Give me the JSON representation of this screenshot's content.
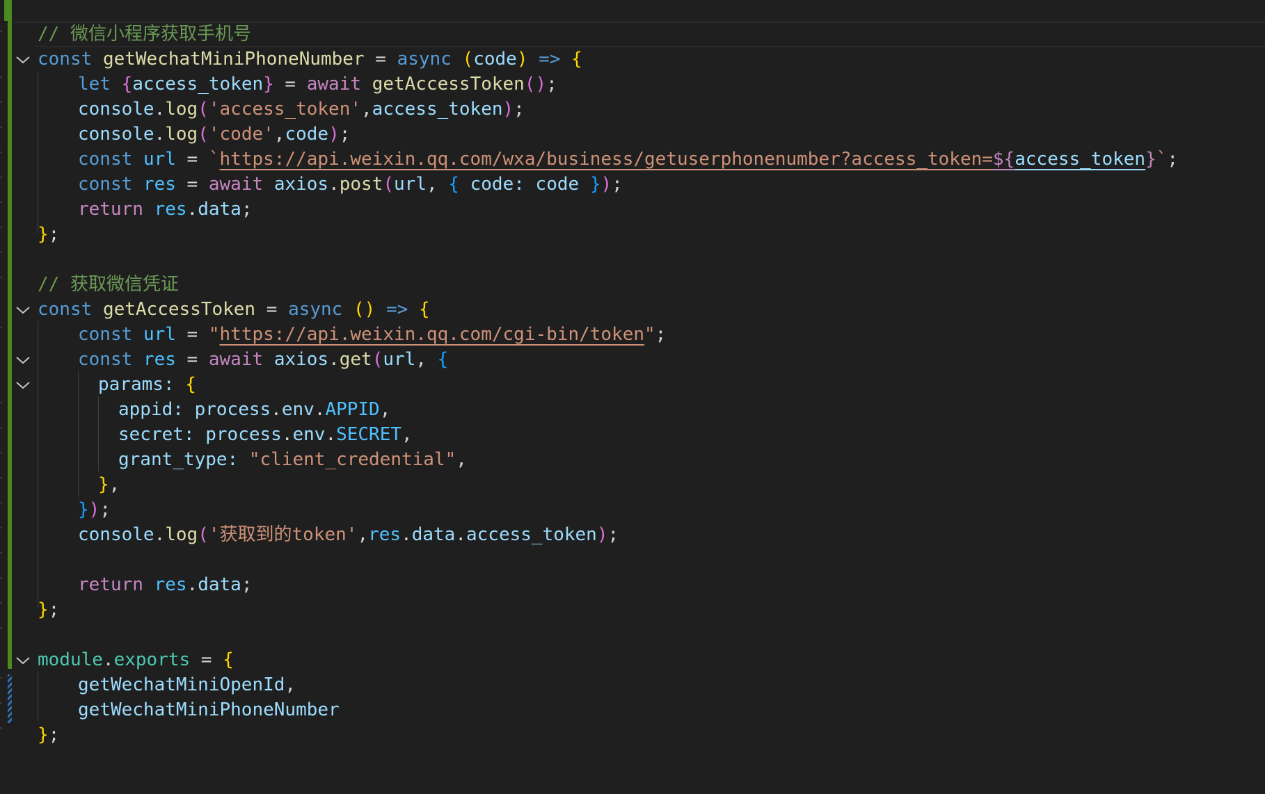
{
  "editor": {
    "language": "javascript",
    "colors": {
      "background": "#1f1f1f",
      "git_added": "#4a8a1e",
      "git_modified": "#2f6fb2"
    },
    "lines": {
      "l1": {
        "comment": "// 微信小程序获取手机号"
      },
      "l2": {
        "kw": "const",
        "name": "getWechatMiniPhoneNumber",
        "eq": " = ",
        "async": "async",
        "open": "(",
        "param": "code",
        "close": ")",
        "arrow": " => ",
        "brace": "{"
      },
      "l3": {
        "kw": "let",
        "bo": "{",
        "var": "access_token",
        "bc": "}",
        "eq": " = ",
        "await": "await",
        "fn": "getAccessToken",
        "call": "()",
        "semi": ";"
      },
      "l4": {
        "obj": "console",
        "dot": ".",
        "fn": "log",
        "po": "(",
        "str": "'access_token'",
        "comma": ",",
        "arg": "access_token",
        "pc": ")",
        "semi": ";"
      },
      "l5": {
        "obj": "console",
        "dot": ".",
        "fn": "log",
        "po": "(",
        "str": "'code'",
        "comma": ",",
        "arg": "code",
        "pc": ")",
        "semi": ";"
      },
      "l6": {
        "kw": "const",
        "var": "url",
        "eq": " = ",
        "tick": "`",
        "url": "https://api.weixin.qq.com/wxa/business/getuserphonenumber?access_token=",
        "interp_open": "${",
        "interp_var": "access_token",
        "interp_close": "}",
        "tick_end": "`",
        "semi": ";"
      },
      "l7": {
        "kw": "const",
        "var": "res",
        "eq": " = ",
        "await": "await",
        "obj": "axios",
        "dot": ".",
        "fn": "post",
        "po": "(",
        "arg": "url",
        "comma": ", ",
        "bo": "{",
        "key": " code: ",
        "val": "code",
        "bc": " }",
        "pc": ")",
        "semi": ";"
      },
      "l8": {
        "kw": "return",
        "obj": "res",
        "dot": ".",
        "prop": "data",
        "semi": ";"
      },
      "l9": {
        "brace": "}",
        "semi": ";"
      },
      "l11": {
        "comment": "// 获取微信凭证"
      },
      "l12": {
        "kw": "const",
        "name": "getAccessToken",
        "eq": " = ",
        "async": "async",
        "parens": "()",
        "arrow": " => ",
        "brace": "{"
      },
      "l13": {
        "kw": "const",
        "var": "url",
        "eq": " = ",
        "q1": "\"",
        "url": "https://api.weixin.qq.com/cgi-bin/token",
        "q2": "\"",
        "semi": ";"
      },
      "l14": {
        "kw": "const",
        "var": "res",
        "eq": " = ",
        "await": "await",
        "obj": "axios",
        "dot": ".",
        "fn": "get",
        "po": "(",
        "arg": "url",
        "comma": ", ",
        "bo": "{"
      },
      "l15": {
        "key": "params: ",
        "bo": "{"
      },
      "l16": {
        "key": "appid: ",
        "obj": "process",
        "dot1": ".",
        "mid": "env",
        "dot2": ".",
        "const": "APPID",
        "comma": ","
      },
      "l17": {
        "key": "secret: ",
        "obj": "process",
        "dot1": ".",
        "mid": "env",
        "dot2": ".",
        "const": "SECRET",
        "comma": ","
      },
      "l18": {
        "key": "grant_type: ",
        "str": "\"client_credential\"",
        "comma": ","
      },
      "l19": {
        "bc": "}",
        "comma": ","
      },
      "l20": {
        "bc": "}",
        "pc": ")",
        "semi": ";"
      },
      "l21": {
        "obj": "console",
        "dot": ".",
        "fn": "log",
        "po": "(",
        "str": "'获取到的token'",
        "comma": ",",
        "a1": "res",
        "d1": ".",
        "a2": "data",
        "d2": ".",
        "a3": "access_token",
        "pc": ")",
        "semi": ";"
      },
      "l23": {
        "kw": "return",
        "obj": "res",
        "dot": ".",
        "prop": "data",
        "semi": ";"
      },
      "l24": {
        "brace": "}",
        "semi": ";"
      },
      "l26": {
        "obj": "module",
        "dot": ".",
        "prop": "exports",
        "eq": " = ",
        "brace": "{"
      },
      "l27": {
        "item": "getWechatMiniOpenId",
        "comma": ","
      },
      "l28": {
        "item": "getWechatMiniPhoneNumber"
      },
      "l29": {
        "brace": "}",
        "semi": ";"
      }
    }
  }
}
